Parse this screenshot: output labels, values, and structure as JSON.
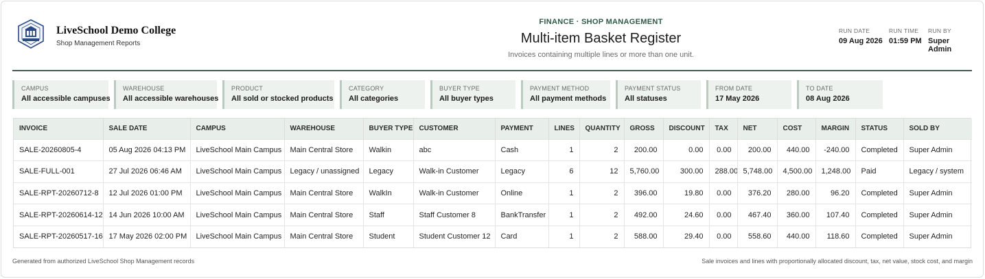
{
  "brand": {
    "name": "LiveSchool Demo College",
    "subtitle": "Shop Management Reports"
  },
  "report": {
    "kicker": "FINANCE · SHOP MANAGEMENT",
    "title": "Multi-item Basket Register",
    "description": "Invoices containing multiple lines or more than one unit."
  },
  "meta": [
    {
      "label": "RUN DATE",
      "value": "09 Aug 2026"
    },
    {
      "label": "RUN TIME",
      "value": "01:59 PM"
    },
    {
      "label": "RUN BY",
      "value": "Super Admin"
    }
  ],
  "filters": [
    {
      "label": "CAMPUS",
      "value": "All accessible campuses"
    },
    {
      "label": "WAREHOUSE",
      "value": "All accessible warehouses"
    },
    {
      "label": "PRODUCT",
      "value": "All sold or stocked products"
    },
    {
      "label": "CATEGORY",
      "value": "All categories"
    },
    {
      "label": "BUYER TYPE",
      "value": "All buyer types"
    },
    {
      "label": "PAYMENT METHOD",
      "value": "All payment methods"
    },
    {
      "label": "PAYMENT STATUS",
      "value": "All statuses"
    },
    {
      "label": "FROM DATE",
      "value": "17 May 2026"
    },
    {
      "label": "TO DATE",
      "value": "08 Aug 2026"
    }
  ],
  "table": {
    "columns": [
      "INVOICE",
      "SALE DATE",
      "CAMPUS",
      "WAREHOUSE",
      "BUYER TYPE",
      "CUSTOMER",
      "PAYMENT",
      "LINES",
      "QUANTITY",
      "GROSS",
      "DISCOUNT",
      "TAX",
      "NET",
      "COST",
      "MARGIN",
      "STATUS",
      "SOLD BY"
    ],
    "rows": [
      [
        "SALE-20260805-4",
        "05 Aug 2026 04:13 PM",
        "LiveSchool Main Campus",
        "Main Central Store",
        "Walkin",
        "abc",
        "Cash",
        "1",
        "2",
        "200.00",
        "0.00",
        "0.00",
        "200.00",
        "440.00",
        "-240.00",
        "Completed",
        "Super Admin"
      ],
      [
        "SALE-FULL-001",
        "27 Jul 2026 06:46 AM",
        "LiveSchool Main Campus",
        "Legacy / unassigned",
        "Legacy",
        "Walk-in Customer",
        "Legacy",
        "6",
        "12",
        "5,760.00",
        "300.00",
        "288.00",
        "5,748.00",
        "4,500.00",
        "1,248.00",
        "Paid",
        "Legacy / system"
      ],
      [
        "SALE-RPT-20260712-8",
        "12 Jul 2026 01:00 PM",
        "LiveSchool Main Campus",
        "Main Central Store",
        "WalkIn",
        "Walk-in Customer",
        "Online",
        "1",
        "2",
        "396.00",
        "19.80",
        "0.00",
        "376.20",
        "280.00",
        "96.20",
        "Completed",
        "Super Admin"
      ],
      [
        "SALE-RPT-20260614-12",
        "14 Jun 2026 10:00 AM",
        "LiveSchool Main Campus",
        "Main Central Store",
        "Staff",
        "Staff Customer 8",
        "BankTransfer",
        "1",
        "2",
        "492.00",
        "24.60",
        "0.00",
        "467.40",
        "360.00",
        "107.40",
        "Completed",
        "Super Admin"
      ],
      [
        "SALE-RPT-20260517-16",
        "17 May 2026 02:00 PM",
        "LiveSchool Main Campus",
        "Main Central Store",
        "Student",
        "Student Customer 12",
        "Card",
        "1",
        "2",
        "588.00",
        "29.40",
        "0.00",
        "558.60",
        "440.00",
        "118.60",
        "Completed",
        "Super Admin"
      ]
    ]
  },
  "footer": {
    "left": "Generated from authorized LiveSchool Shop Management records",
    "right": "Sale invoices and lines with proportionally allocated discount, tax, net value, stock cost, and margin"
  }
}
